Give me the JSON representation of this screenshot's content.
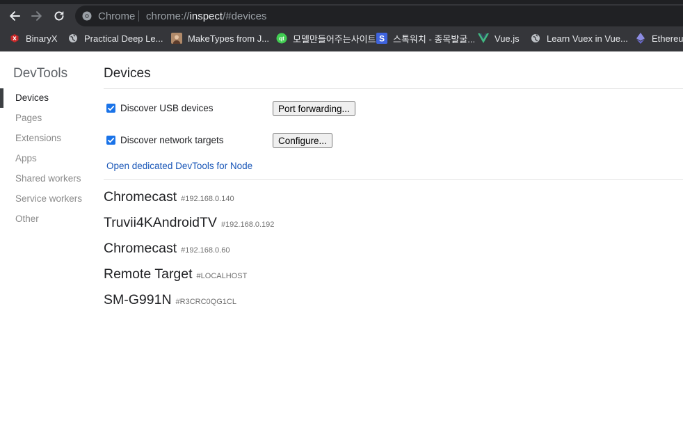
{
  "browser": {
    "omnibox": {
      "chip_label": "Chrome",
      "url_scheme": "chrome://",
      "url_host": "inspect",
      "url_path": "/#devices"
    },
    "bookmarks": [
      {
        "label": "BinaryX",
        "icon": "binaryx-icon"
      },
      {
        "label": "Practical Deep Le...",
        "icon": "globe-icon"
      },
      {
        "label": "MakeTypes from J...",
        "icon": "avatar-icon"
      },
      {
        "label": "모델만들어주는사이트",
        "icon": "qt-icon"
      },
      {
        "label": "스톡워치 - 종목발굴...",
        "icon": "s-icon"
      },
      {
        "label": "Vue.js",
        "icon": "vue-icon"
      },
      {
        "label": "Learn Vuex in Vue...",
        "icon": "globe-icon"
      },
      {
        "label": "Ethereum",
        "icon": "ethereum-icon"
      }
    ],
    "colors": {
      "toolbar_bg": "#35363a",
      "omnibox_bg": "#202124",
      "vue_green": "#41b883",
      "qt_green": "#41cd52",
      "s_blue": "#3e63dd"
    }
  },
  "sidebar": {
    "title": "DevTools",
    "items": [
      {
        "label": "Devices",
        "active": true
      },
      {
        "label": "Pages",
        "active": false
      },
      {
        "label": "Extensions",
        "active": false
      },
      {
        "label": "Apps",
        "active": false
      },
      {
        "label": "Shared workers",
        "active": false
      },
      {
        "label": "Service workers",
        "active": false
      },
      {
        "label": "Other",
        "active": false
      }
    ]
  },
  "main": {
    "title": "Devices",
    "discover_usb": {
      "label": "Discover USB devices",
      "checked": true
    },
    "discover_network": {
      "label": "Discover network targets",
      "checked": true
    },
    "port_forwarding_label": "Port forwarding...",
    "configure_label": "Configure...",
    "node_link_label": "Open dedicated DevTools for Node",
    "devices": [
      {
        "name": "Chromecast",
        "id": "#192.168.0.140"
      },
      {
        "name": "Truvii4KAndroidTV",
        "id": "#192.168.0.192"
      },
      {
        "name": "Chromecast",
        "id": "#192.168.0.60"
      },
      {
        "name": "Remote Target",
        "id": "#LOCALHOST"
      },
      {
        "name": "SM-G991N",
        "id": "#R3CRC0QG1CL"
      }
    ],
    "colors": {
      "checkbox": "#1a73e8",
      "link": "#1a57b8"
    }
  }
}
